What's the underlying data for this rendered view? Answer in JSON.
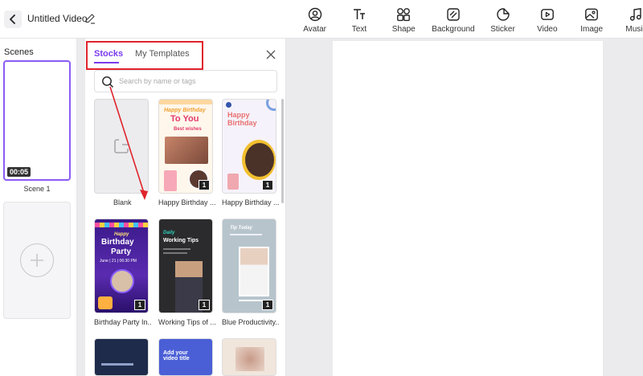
{
  "header": {
    "title": "Untitled Video",
    "tools": [
      {
        "label": "Avatar",
        "icon": "avatar-icon"
      },
      {
        "label": "Text",
        "icon": "text-icon"
      },
      {
        "label": "Shape",
        "icon": "shape-icon"
      },
      {
        "label": "Background",
        "icon": "background-icon"
      },
      {
        "label": "Sticker",
        "icon": "sticker-icon"
      },
      {
        "label": "Video",
        "icon": "video-icon"
      },
      {
        "label": "Image",
        "icon": "image-icon"
      },
      {
        "label": "Music",
        "icon": "music-icon"
      }
    ]
  },
  "scenes": {
    "label": "Scenes",
    "items": [
      {
        "name": "Scene 1",
        "duration": "00:05"
      }
    ]
  },
  "panel": {
    "tabs": [
      {
        "label": "Stocks",
        "active": true
      },
      {
        "label": "My Templates",
        "active": false
      }
    ],
    "search_placeholder": "Search by name or tags",
    "templates": [
      {
        "label": "Blank"
      },
      {
        "label": "Happy Birthday ...",
        "count": "1",
        "heading": "Happy Birthday",
        "sub": "To You",
        "wish": "Best wishes"
      },
      {
        "label": "Happy Birthday ...",
        "count": "1",
        "heading": "Happy",
        "sub": "Birthday"
      },
      {
        "label": "Birthday Party In...",
        "count": "1",
        "kicker": "Happy",
        "heading": "Birthday",
        "sub": "Party",
        "date": "June | 21 | 06:30 PM"
      },
      {
        "label": "Working Tips of ...",
        "count": "1",
        "kicker": "Daily",
        "heading": "Working Tips"
      },
      {
        "label": "Blue Productivity...",
        "count": "1",
        "kicker": "Tip Today"
      },
      {
        "label": ""
      },
      {
        "label": "",
        "heading": "Add your video title"
      },
      {
        "label": ""
      }
    ]
  },
  "colors": {
    "accent": "#7c3aed",
    "annotation": "#e0242c"
  }
}
